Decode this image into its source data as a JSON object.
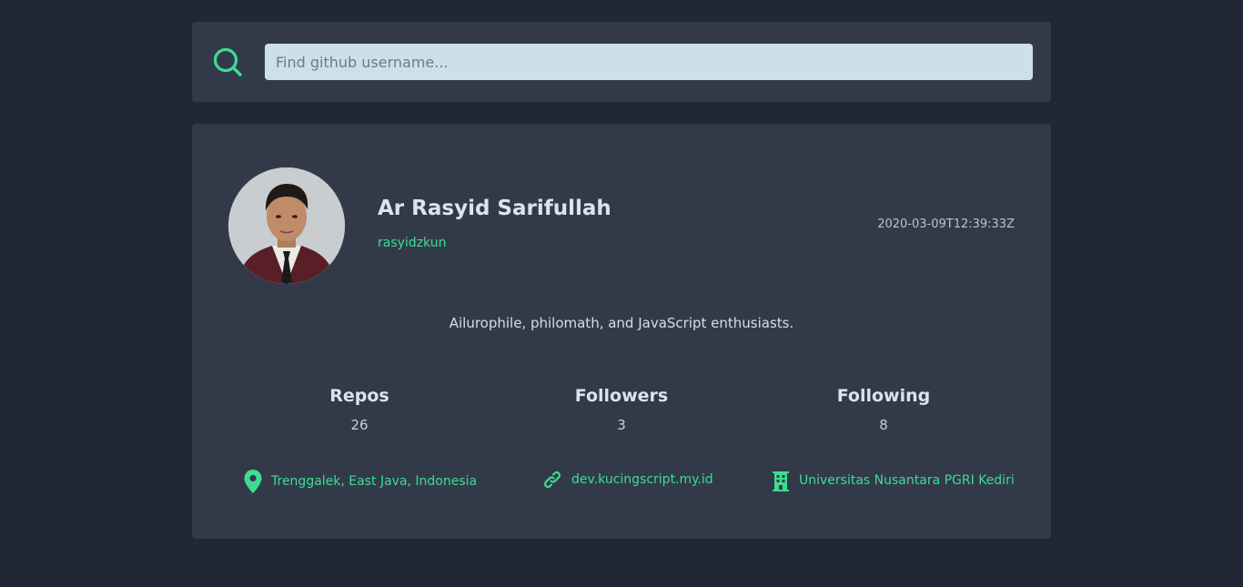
{
  "search": {
    "placeholder": "Find github username...",
    "icon": "search-icon",
    "value": ""
  },
  "colors": {
    "background": "#212734",
    "card": "#323a4a",
    "accent": "#3fdc92",
    "input": "#cde0e7"
  },
  "profile": {
    "name": "Ar Rasyid Sarifullah",
    "login": "rasyidzkun",
    "created_at": "2020-03-09T12:39:33Z",
    "bio": "Ailurophile, philomath, and JavaScript enthusiasts."
  },
  "stats": [
    {
      "label": "Repos",
      "value": "26"
    },
    {
      "label": "Followers",
      "value": "3"
    },
    {
      "label": "Following",
      "value": "8"
    }
  ],
  "info": {
    "location": {
      "icon": "location-pin-icon",
      "text": "Trenggalek, East Java, Indonesia"
    },
    "website": {
      "icon": "link-icon",
      "text": "dev.kucingscript.my.id"
    },
    "company": {
      "icon": "building-icon",
      "text": "Universitas Nusantara PGRI Kediri"
    }
  }
}
